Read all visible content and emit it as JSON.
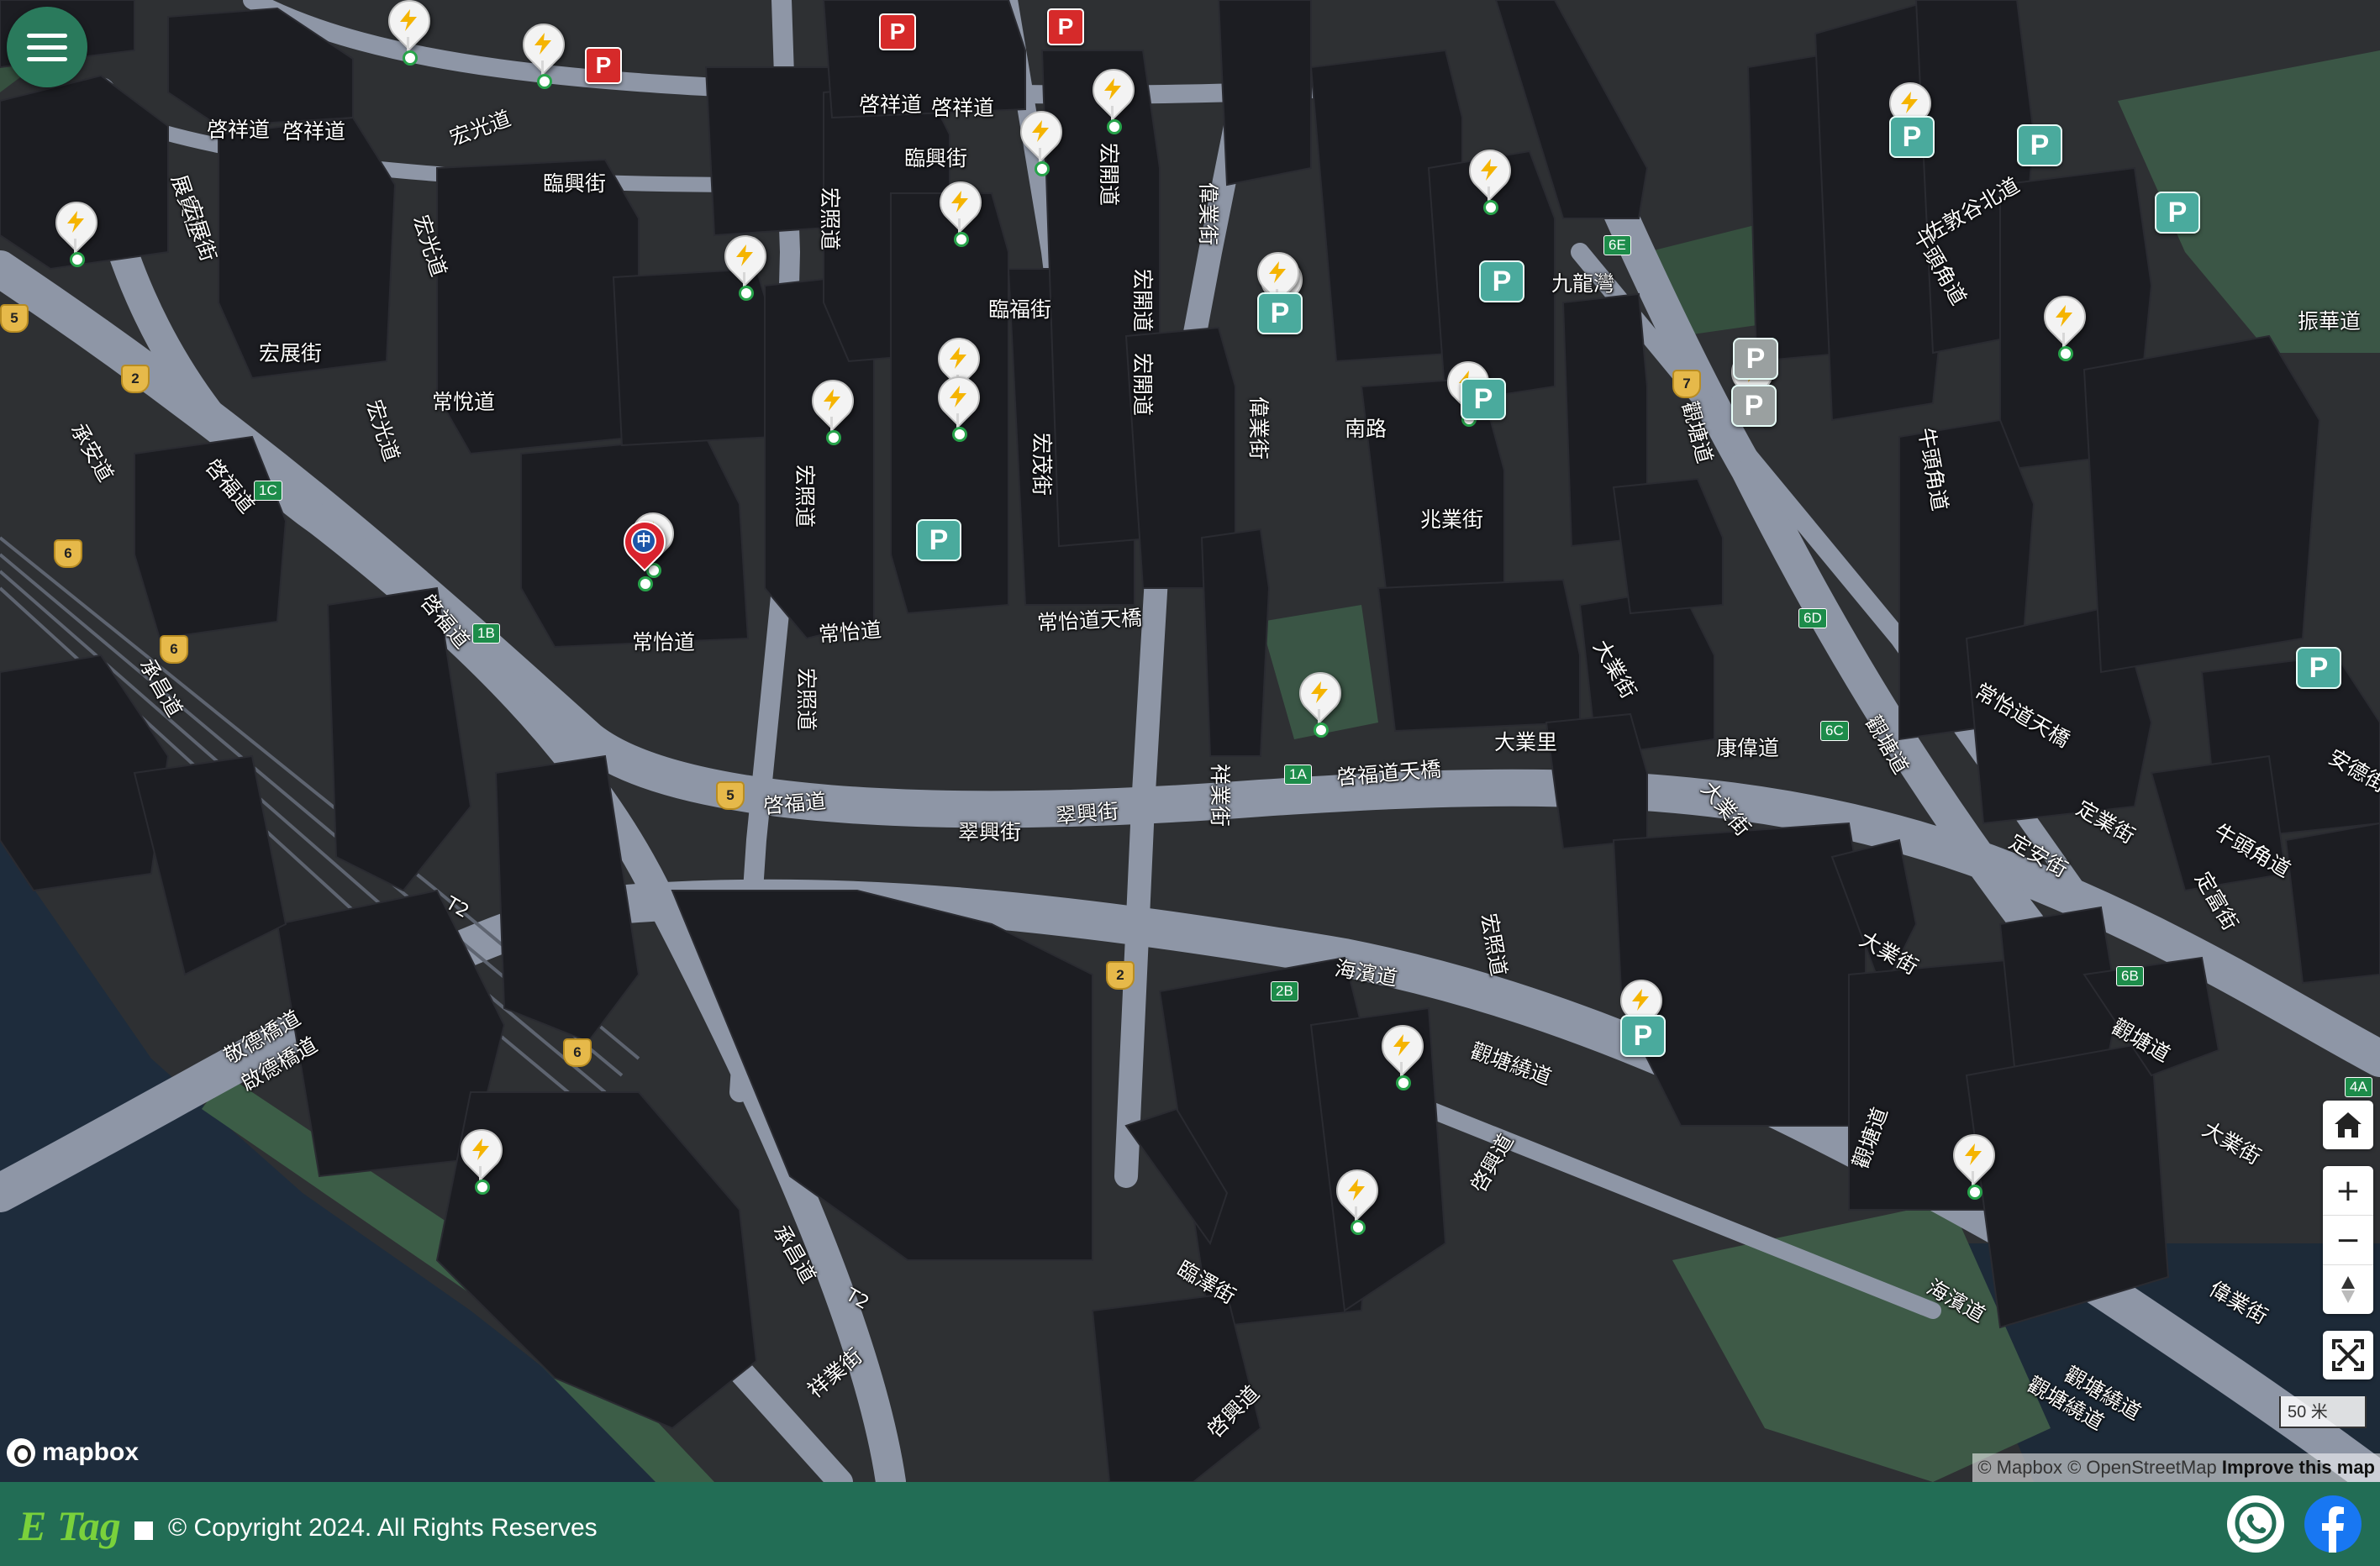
{
  "map": {
    "streets": [
      {
        "name": "啓祥道"
      },
      {
        "name": "啓祥道"
      },
      {
        "name": "啓祥道"
      },
      {
        "name": "啓祥道"
      },
      {
        "name": "宏光道"
      },
      {
        "name": "臨興街"
      },
      {
        "name": "臨興街"
      },
      {
        "name": "展貿徑"
      },
      {
        "name": "宏展街"
      },
      {
        "name": "宏光道"
      },
      {
        "name": "宏展街"
      },
      {
        "name": "常悅道"
      },
      {
        "name": "宏照道"
      },
      {
        "name": "宏開道"
      },
      {
        "name": "臨福街"
      },
      {
        "name": "偉業街"
      },
      {
        "name": "宏開道"
      },
      {
        "name": "宏開道"
      },
      {
        "name": "宏茂街"
      },
      {
        "name": "偉業街"
      },
      {
        "name": "南路"
      },
      {
        "name": "兆業街"
      },
      {
        "name": "九龍灣"
      },
      {
        "name": "承安道"
      },
      {
        "name": "啓福道"
      },
      {
        "name": "宏光道"
      },
      {
        "name": "宏照道"
      },
      {
        "name": "常怡道"
      },
      {
        "name": "常怡道"
      },
      {
        "name": "常怡道天橋"
      },
      {
        "name": "啓福道"
      },
      {
        "name": "宏照道"
      },
      {
        "name": "承昌道"
      },
      {
        "name": "啓福道"
      },
      {
        "name": "翠興街"
      },
      {
        "name": "翠興街"
      },
      {
        "name": "祥業街"
      },
      {
        "name": "啓福道天橋"
      },
      {
        "name": "大業里"
      },
      {
        "name": "康偉道"
      },
      {
        "name": "大業街"
      },
      {
        "name": "大業街"
      },
      {
        "name": "觀塘道"
      },
      {
        "name": "觀塘道"
      },
      {
        "name": "牛頭角道"
      },
      {
        "name": "佐敦谷北道"
      },
      {
        "name": "牛頭角道"
      },
      {
        "name": "振華道"
      },
      {
        "name": "常怡道天橋"
      },
      {
        "name": "安德街"
      },
      {
        "name": "定業街"
      },
      {
        "name": "定安街"
      },
      {
        "name": "牛頭角道"
      },
      {
        "name": "定富街"
      },
      {
        "name": "大業街"
      },
      {
        "name": "宏照道"
      },
      {
        "name": "海濱道"
      },
      {
        "name": "觀塘繞道"
      },
      {
        "name": "啓興道"
      },
      {
        "name": "觀塘繞道"
      },
      {
        "name": "敬德橋道"
      },
      {
        "name": "啟德橋道"
      },
      {
        "name": "承昌道"
      },
      {
        "name": "祥業街"
      },
      {
        "name": "臨澤街"
      },
      {
        "name": "啓興道"
      },
      {
        "name": "海濱道"
      },
      {
        "name": "觀塘繞道"
      },
      {
        "name": "偉業街"
      },
      {
        "name": "觀塘道"
      },
      {
        "name": "大業街"
      },
      {
        "name": "觀塘道"
      }
    ],
    "route_shields": [
      {
        "num": "5"
      },
      {
        "num": "2"
      },
      {
        "num": "6"
      },
      {
        "num": "6"
      },
      {
        "num": "5"
      },
      {
        "num": "2"
      },
      {
        "num": "6"
      },
      {
        "num": "7"
      }
    ],
    "exit_labels": [
      {
        "text": "1C"
      },
      {
        "text": "1B"
      },
      {
        "text": "1A"
      },
      {
        "text": "6E"
      },
      {
        "text": "6D"
      },
      {
        "text": "6C"
      },
      {
        "text": "6B"
      },
      {
        "text": "2B"
      },
      {
        "text": "4A"
      }
    ],
    "road_codes": [
      {
        "text": "T2"
      },
      {
        "text": "T2"
      }
    ],
    "charger_pins": 28,
    "parking_icon": "P",
    "selected_marker_icon": "中"
  },
  "controls": {
    "menu": "menu-icon",
    "home": "home-icon",
    "zoom_in": "+",
    "zoom_out": "−",
    "compass": "compass-icon",
    "fullscreen": "fullscreen-icon"
  },
  "scale": "50 米",
  "attribution": {
    "mapbox": "© Mapbox",
    "osm": "© OpenStreetMap",
    "improve": "Improve this map"
  },
  "mapbox_logo": "mapbox",
  "footer": {
    "logo": "E Tag",
    "copyright": "© Copyright 2024. All Rights Reserves",
    "whatsapp": "whatsapp-icon",
    "facebook": "facebook-icon"
  },
  "colors": {
    "footer_bg": "#226d55",
    "accent": "#2a7a5c",
    "parking": "#4aaa9d",
    "paid_parking": "#d62a2a",
    "charger_ring": "#27a34a"
  }
}
